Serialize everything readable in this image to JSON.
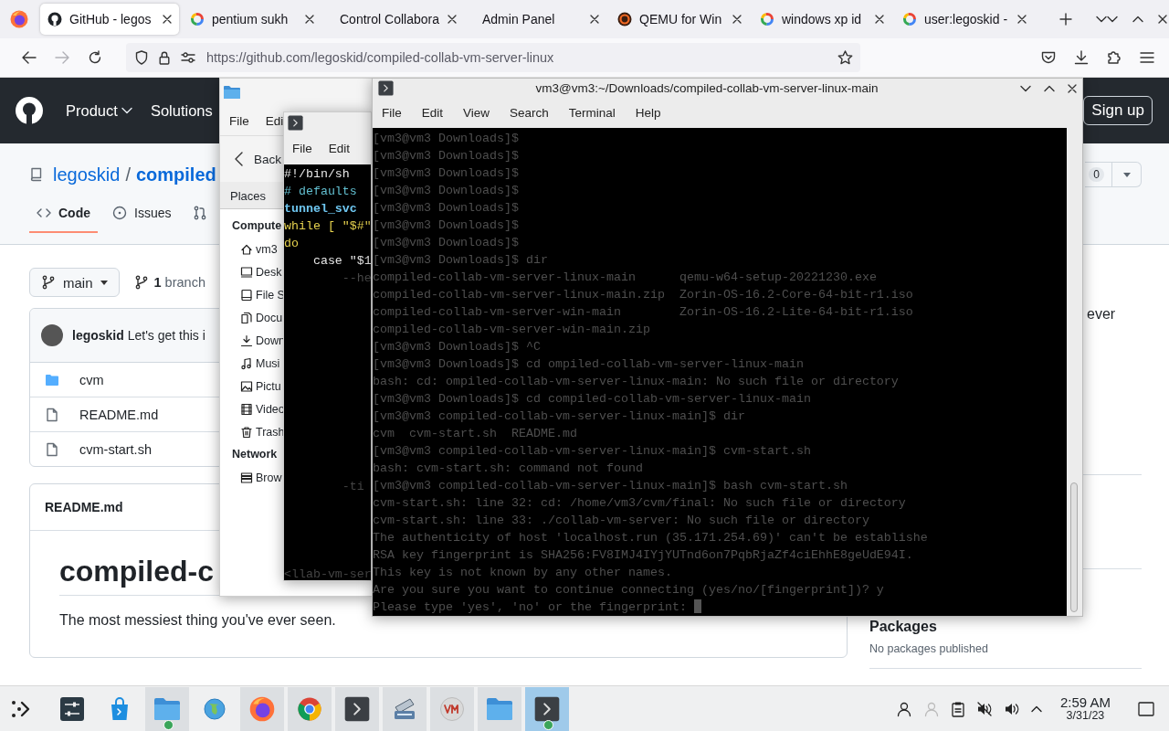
{
  "browser": {
    "tabs": [
      {
        "title": "GitHub - legos",
        "kind": "github",
        "selected": true
      },
      {
        "title": "pentium sukh",
        "kind": "google",
        "selected": false
      },
      {
        "title": "Control Collabora",
        "kind": "plain",
        "selected": false
      },
      {
        "title": "Admin Panel",
        "kind": "plain",
        "selected": false
      },
      {
        "title": "QEMU for Win",
        "kind": "qemu",
        "selected": false
      },
      {
        "title": "windows xp id",
        "kind": "google",
        "selected": false
      },
      {
        "title": "user:legoskid -",
        "kind": "google",
        "selected": false
      }
    ],
    "forward_disabled": true,
    "url": "https://github.com/legoskid/compiled-collab-vm-server-linux"
  },
  "github": {
    "header": {
      "menu": [
        {
          "label": "Product",
          "caret": true
        },
        {
          "label": "Solutions",
          "caret": false
        }
      ],
      "sign_up": "Sign up"
    },
    "repo": {
      "owner": "legoskid",
      "separator": "/",
      "name": "compiled",
      "watch_count": "0"
    },
    "tabs": [
      {
        "label": "Code",
        "kind": "code",
        "selected": true
      },
      {
        "label": "Issues",
        "kind": "issue",
        "selected": false
      },
      {
        "kind": "pull",
        "selected": false
      }
    ],
    "branch": {
      "name": "main",
      "count": "**1** branch"
    },
    "commit": "**legoskid** Let's get this i",
    "files": [
      {
        "name": "cvm",
        "kind": "folder"
      },
      {
        "name": "README.md",
        "kind": "file"
      },
      {
        "name": "cvm-start.sh",
        "kind": "file"
      }
    ],
    "readme": {
      "label": "README.md",
      "heading": "compiled-c",
      "text": "The most messiest thing you've ever seen."
    },
    "sidebar": {
      "about_fragment": "ever",
      "packages_heading": "Packages",
      "packages_text": "No packages published"
    }
  },
  "file_manager": {
    "menu": [
      "File",
      "Edi"
    ],
    "back": "Back",
    "places": "Places",
    "sections": [
      {
        "title": "Compute",
        "items": [
          {
            "label": "vm3",
            "kind": "home"
          },
          {
            "label": "Desk",
            "kind": "desktop"
          },
          {
            "label": "File S",
            "kind": "drive"
          },
          {
            "label": "Docu",
            "kind": "documents"
          },
          {
            "label": "Down",
            "kind": "download"
          },
          {
            "label": "Musi",
            "kind": "music"
          },
          {
            "label": "Pictu",
            "kind": "pictures"
          },
          {
            "label": "Video",
            "kind": "video"
          },
          {
            "label": "Trash",
            "kind": "trash"
          }
        ]
      },
      {
        "title": "Network",
        "items": [
          {
            "label": "Brow",
            "kind": "network"
          }
        ]
      }
    ]
  },
  "editor": {
    "menu": [
      "File",
      "Edit"
    ],
    "lines": [
      {
        "text": "#!/bin/sh",
        "kind": "plain"
      },
      {
        "text": "# defaults",
        "kind": "comment"
      },
      {
        "text": "tunnel_svc",
        "kind": "variable"
      },
      {
        "text": "while [ \"$#\"",
        "kind": "keyword"
      },
      {
        "text": "do",
        "kind": "keyword"
      },
      {
        "text": "    case \"$1",
        "kind": "plain"
      },
      {
        "text": "        --he",
        "kind": "faint"
      }
    ],
    "tail": [
      "        -ti",
      "<llab-vm-ser"
    ]
  },
  "terminal": {
    "title": "vm3@vm3:~/Downloads/compiled-collab-vm-server-linux-main",
    "menu": [
      "File",
      "Edit",
      "View",
      "Search",
      "Terminal",
      "Help"
    ],
    "lines": [
      "[vm3@vm3 Downloads]$",
      "[vm3@vm3 Downloads]$",
      "[vm3@vm3 Downloads]$",
      "[vm3@vm3 Downloads]$",
      "[vm3@vm3 Downloads]$",
      "[vm3@vm3 Downloads]$",
      "[vm3@vm3 Downloads]$",
      "[vm3@vm3 Downloads]$ dir",
      "compiled-collab-vm-server-linux-main      qemu-w64-setup-20221230.exe",
      "compiled-collab-vm-server-linux-main.zip  Zorin-OS-16.2-Core-64-bit-r1.iso",
      "compiled-collab-vm-server-win-main        Zorin-OS-16.2-Lite-64-bit-r1.iso",
      "compiled-collab-vm-server-win-main.zip",
      "[vm3@vm3 Downloads]$ ^C",
      "[vm3@vm3 Downloads]$ cd ompiled-collab-vm-server-linux-main",
      "bash: cd: ompiled-collab-vm-server-linux-main: No such file or directory",
      "[vm3@vm3 Downloads]$ cd compiled-collab-vm-server-linux-main",
      "[vm3@vm3 compiled-collab-vm-server-linux-main]$ dir",
      "cvm  cvm-start.sh  README.md",
      "[vm3@vm3 compiled-collab-vm-server-linux-main]$ cvm-start.sh",
      "bash: cvm-start.sh: command not found",
      "[vm3@vm3 compiled-collab-vm-server-linux-main]$ bash cvm-start.sh",
      "cvm-start.sh: line 32: cd: /home/vm3/cvm/final: No such file or directory",
      "cvm-start.sh: line 33: ./collab-vm-server: No such file or directory",
      "The authenticity of host 'localhost.run (35.171.254.69)' can't be establishe",
      "RSA key fingerprint is SHA256:FV8IMJ4IYjYUTnd6on7PqbRjaZf4ciEhhE8geUdE94I.",
      "This key is not known by any other names.",
      "Are you sure you want to continue connecting (yes/no/[fingerprint])? y",
      "Please type 'yes', 'no' or the fingerprint: "
    ]
  },
  "taskbar": {
    "apps": [
      {
        "kind": "settings",
        "running": false,
        "focused": false,
        "badge": false
      },
      {
        "kind": "store",
        "running": false,
        "focused": false,
        "badge": false
      },
      {
        "kind": "files",
        "running": true,
        "focused": false,
        "badge": true
      },
      {
        "kind": "globe",
        "running": false,
        "focused": false,
        "badge": false
      },
      {
        "kind": "firefox",
        "running": true,
        "focused": false,
        "badge": false
      },
      {
        "kind": "chrome",
        "running": true,
        "focused": false,
        "badge": false
      },
      {
        "kind": "terminal",
        "running": true,
        "focused": false,
        "badge": false
      },
      {
        "kind": "scanner",
        "running": true,
        "focused": false,
        "badge": false
      },
      {
        "kind": "vm",
        "running": true,
        "focused": false,
        "badge": false
      },
      {
        "kind": "folder",
        "running": true,
        "focused": false,
        "badge": false
      },
      {
        "kind": "terminal",
        "running": true,
        "focused": true,
        "badge": true
      }
    ],
    "time": "2:59 AM",
    "date": "3/31/23"
  }
}
